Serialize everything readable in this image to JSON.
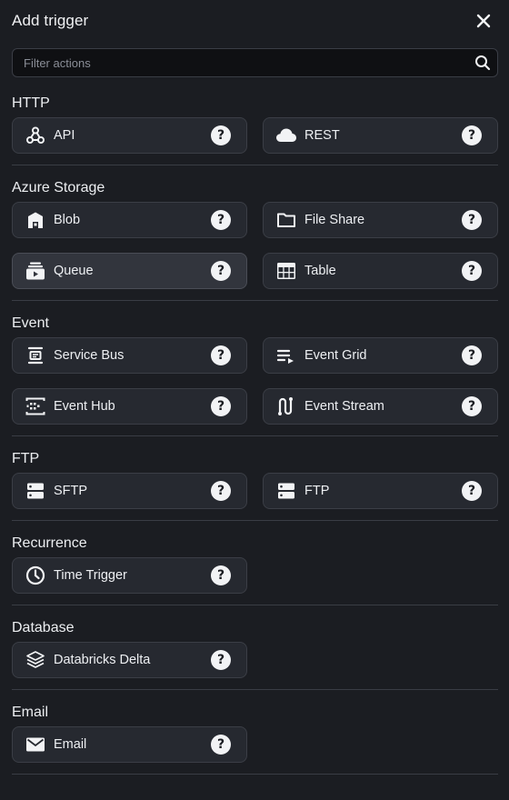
{
  "header": {
    "title": "Add trigger"
  },
  "search": {
    "placeholder": "Filter actions"
  },
  "sections": [
    {
      "title": "HTTP",
      "items": [
        {
          "label": "API",
          "icon": "webhook-icon",
          "help": "?"
        },
        {
          "label": "REST",
          "icon": "cloud-icon",
          "help": "?"
        }
      ]
    },
    {
      "title": "Azure Storage",
      "items": [
        {
          "label": "Blob",
          "icon": "blob-icon",
          "help": "?"
        },
        {
          "label": "File Share",
          "icon": "folder-icon",
          "help": "?"
        },
        {
          "label": "Queue",
          "icon": "queue-icon",
          "help": "?"
        },
        {
          "label": "Table",
          "icon": "table-icon",
          "help": "?"
        }
      ]
    },
    {
      "title": "Event",
      "items": [
        {
          "label": "Service Bus",
          "icon": "service-bus-icon",
          "help": "?"
        },
        {
          "label": "Event Grid",
          "icon": "event-grid-icon",
          "help": "?"
        },
        {
          "label": "Event Hub",
          "icon": "event-hub-icon",
          "help": "?"
        },
        {
          "label": "Event Stream",
          "icon": "event-stream-icon",
          "help": "?"
        }
      ]
    },
    {
      "title": "FTP",
      "items": [
        {
          "label": "SFTP",
          "icon": "server-icon",
          "help": "?"
        },
        {
          "label": "FTP",
          "icon": "server-icon",
          "help": "?"
        }
      ]
    },
    {
      "title": "Recurrence",
      "items": [
        {
          "label": "Time Trigger",
          "icon": "clock-icon",
          "help": "?"
        }
      ]
    },
    {
      "title": "Database",
      "items": [
        {
          "label": "Databricks Delta",
          "icon": "layers-icon",
          "help": "?"
        }
      ]
    },
    {
      "title": "Email",
      "items": [
        {
          "label": "Email",
          "icon": "mail-icon",
          "help": "?"
        }
      ]
    }
  ],
  "colors": {
    "background": "#1b1d22",
    "card": "#262930",
    "card_active": "#32353d",
    "border": "#3b3e46"
  }
}
